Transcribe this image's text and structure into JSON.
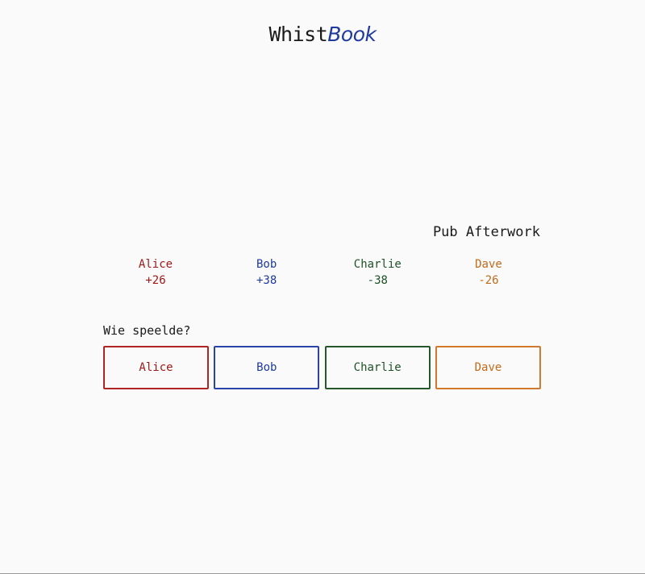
{
  "app": {
    "title_part1": "Whist",
    "title_part2": "Book"
  },
  "game": {
    "name": "Pub Afterwork"
  },
  "colors": {
    "red": "#a01818",
    "blue": "#1f3a9e",
    "green": "#1d5226",
    "orange": "#c26a1a"
  },
  "players": [
    {
      "name": "Alice",
      "score": "+26",
      "color": "red"
    },
    {
      "name": "Bob",
      "score": "+38",
      "color": "blue"
    },
    {
      "name": "Charlie",
      "score": "-38",
      "color": "green"
    },
    {
      "name": "Dave",
      "score": "-26",
      "color": "orange"
    }
  ],
  "prompt": {
    "label": "Wie speelde?"
  }
}
